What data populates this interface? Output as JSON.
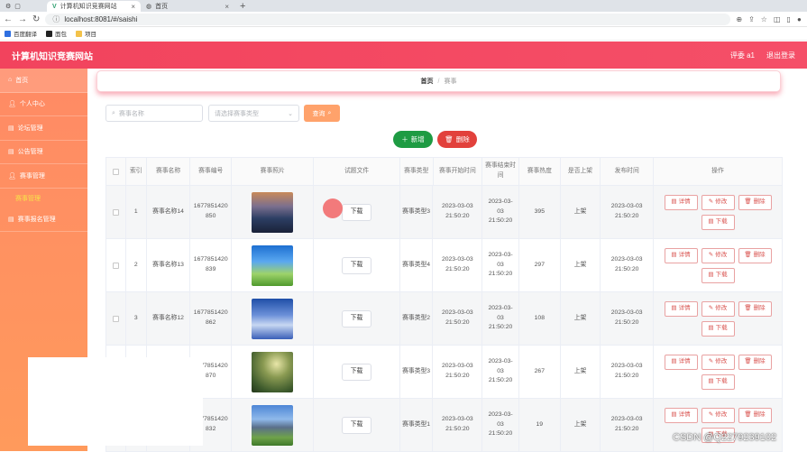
{
  "browser": {
    "tabs": [
      {
        "label": "计算机知识竞赛网站",
        "close": "×"
      },
      {
        "label": "首页",
        "close": "×"
      }
    ],
    "new_tab": "+",
    "url": "localhost:8081/#/saishi",
    "bookmarks": [
      "百度翻译",
      "面包",
      "项目"
    ]
  },
  "header": {
    "title": "计算机知识竞赛网站",
    "user": "评委 a1",
    "logout": "退出登录",
    "color": "#f2435d"
  },
  "sidebar": {
    "items": [
      {
        "label": "首页",
        "icon": "home-icon"
      },
      {
        "label": "个人中心",
        "icon": "user-icon"
      },
      {
        "label": "论坛管理",
        "icon": "forum-icon"
      },
      {
        "label": "公告管理",
        "icon": "notice-icon"
      },
      {
        "label": "赛事管理",
        "icon": "user-icon"
      },
      {
        "label": "赛事报名管理",
        "icon": "register-icon"
      }
    ],
    "sub_item": "赛事管理"
  },
  "breadcrumb": {
    "home": "首页",
    "sep": "/",
    "current": "赛事"
  },
  "search": {
    "name_placeholder": "赛事名称",
    "type_placeholder": "请选择赛事类型",
    "button": "查询"
  },
  "actions": {
    "add": "新增",
    "delete": "删除"
  },
  "table": {
    "columns": [
      "索引",
      "赛事名称",
      "赛事编号",
      "赛事照片",
      "试题文件",
      "赛事类型",
      "赛事开始时间",
      "赛事结束时间",
      "赛事热度",
      "是否上架",
      "发布时间",
      "操作"
    ],
    "download": "下载",
    "ops": {
      "detail": "详情",
      "edit": "修改",
      "delete": "删除",
      "download": "下载"
    },
    "rows": [
      {
        "index": "1",
        "name": "赛事名称14",
        "number": "1677851420850",
        "type": "赛事类型3",
        "start": "2023-03-03 21:50:20",
        "end": "2023-03-03 21:50:20",
        "heat": "395",
        "shelf": "上架",
        "publish": "2023-03-03 21:50:20"
      },
      {
        "index": "2",
        "name": "赛事名称13",
        "number": "1677851420839",
        "type": "赛事类型4",
        "start": "2023-03-03 21:50:20",
        "end": "2023-03-03 21:50:20",
        "heat": "297",
        "shelf": "上架",
        "publish": "2023-03-03 21:50:20"
      },
      {
        "index": "3",
        "name": "赛事名称12",
        "number": "1677851420862",
        "type": "赛事类型2",
        "start": "2023-03-03 21:50:20",
        "end": "2023-03-03 21:50:20",
        "heat": "108",
        "shelf": "上架",
        "publish": "2023-03-03 21:50:20"
      },
      {
        "index": "",
        "name": "",
        "number": "1677851420870",
        "type": "赛事类型3",
        "start": "2023-03-03 21:50:20",
        "end": "2023-03-03 21:50:20",
        "heat": "267",
        "shelf": "上架",
        "publish": "2023-03-03 21:50:20"
      },
      {
        "index": "",
        "name": "",
        "number": "1677851420832",
        "type": "赛事类型1",
        "start": "2023-03-03 21:50:20",
        "end": "2023-03-03 21:50:20",
        "heat": "19",
        "shelf": "上架",
        "publish": "2023-03-03 21:50:20"
      }
    ]
  },
  "watermark": "CSDN @Q2279239102"
}
